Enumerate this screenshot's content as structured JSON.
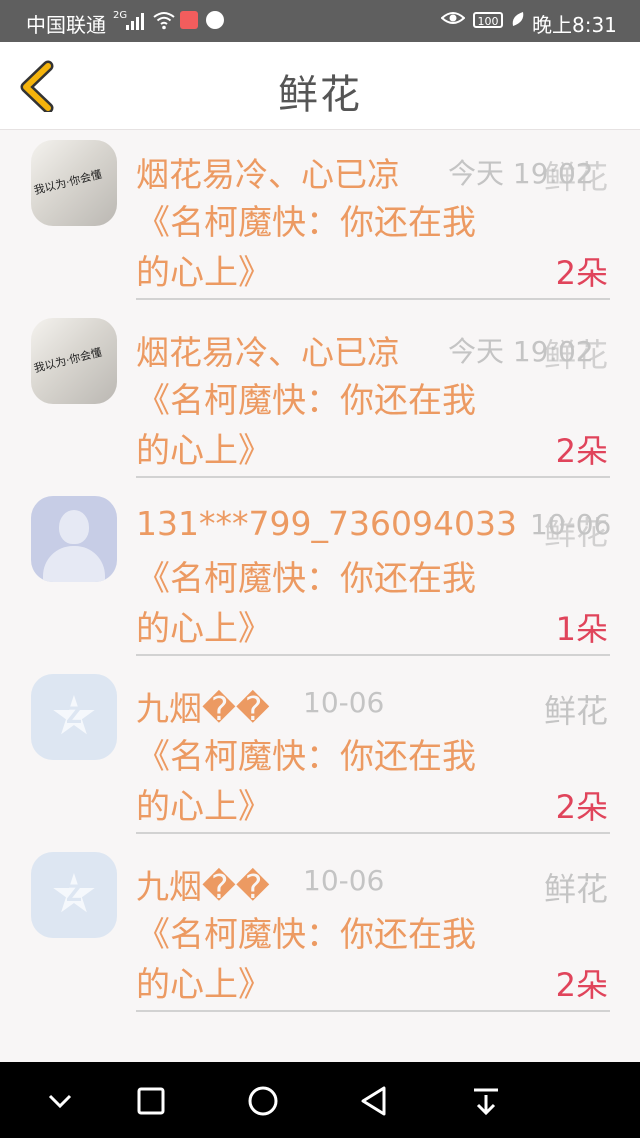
{
  "status_bar": {
    "carrier": "中国联通",
    "signal_label": "2G",
    "battery": "100",
    "time": "晚上8:31"
  },
  "header": {
    "title": "鲜花"
  },
  "items": [
    {
      "user": "烟花易冷、心已凉",
      "time": "今天 19:02",
      "type": "鲜花",
      "work_line1": "《名柯魔快：你还在我",
      "work_line2": "的心上》",
      "count": "2朵",
      "avatar_caption": "我以为·你会懂",
      "avatar": "photo-avatar"
    },
    {
      "user": "烟花易冷、心已凉",
      "time": "今天 19:02",
      "type": "鲜花",
      "work_line1": "《名柯魔快：你还在我",
      "work_line2": "的心上》",
      "count": "2朵",
      "avatar_caption": "我以为·你会懂",
      "avatar": "photo-avatar"
    },
    {
      "user": "131***799_736094033",
      "time": "10-06",
      "type": "鲜花",
      "work_line1": "《名柯魔快：你还在我",
      "work_line2": "的心上》",
      "count": "1朵",
      "avatar": "default-user-avatar"
    },
    {
      "user": "九烟��",
      "time": "10-06",
      "type": "鲜花",
      "work_line1": "《名柯魔快：你还在我",
      "work_line2": "的心上》",
      "count": "2朵",
      "avatar": "qq-avatar"
    },
    {
      "user": "九烟��",
      "time": "10-06",
      "type": "鲜花",
      "work_line1": "《名柯魔快：你还在我",
      "work_line2": "的心上》",
      "count": "2朵",
      "avatar": "qq-avatar"
    }
  ],
  "nav_bar": {
    "icons": [
      "chevron-down-icon",
      "square-icon",
      "circle-home-icon",
      "triangle-back-icon",
      "download-icon"
    ]
  },
  "colors": {
    "accent_orange": "#ec9a62",
    "count_red": "#e0445b",
    "back_yellow": "#f5b40c"
  }
}
